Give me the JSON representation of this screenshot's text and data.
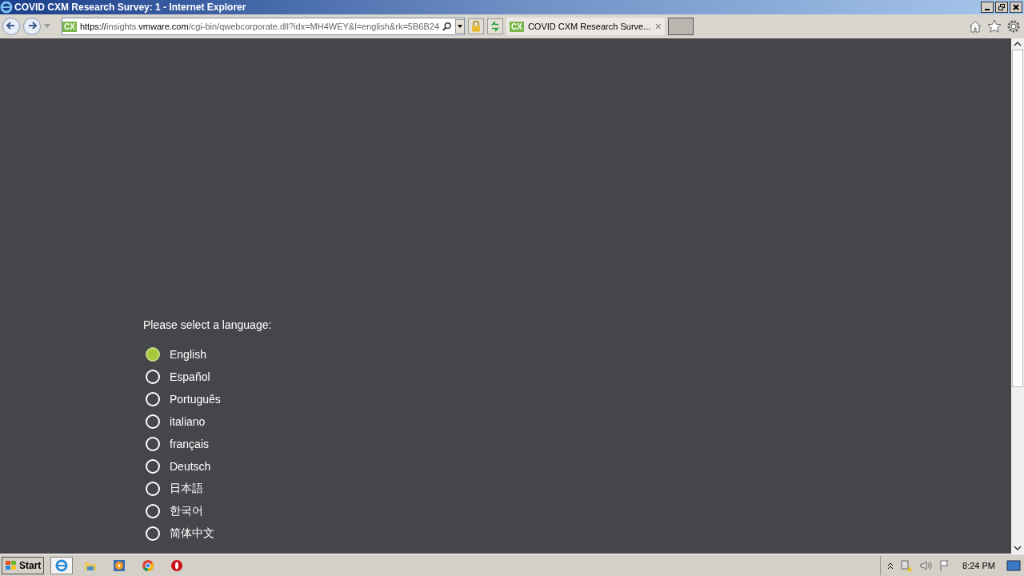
{
  "window": {
    "title": "COVID CXM Research Survey: 1 - Internet Explorer"
  },
  "address_bar": {
    "scheme": "https://",
    "host_prefix": "insights.",
    "host_main": "vmware.com",
    "path": "/cgi-bin/qwebcorporate.dll?idx=MH4WEY&l=english&rk=5B6B24",
    "site_icon": "CX"
  },
  "tabs": [
    {
      "icon": "CX",
      "label": "COVID CXM Research Surve...",
      "selected": true,
      "close": "×"
    }
  ],
  "survey": {
    "question": "Please select a language:",
    "options": [
      {
        "label": "English",
        "selected": true
      },
      {
        "label": "Español",
        "selected": false
      },
      {
        "label": "Português",
        "selected": false
      },
      {
        "label": "italiano",
        "selected": false
      },
      {
        "label": "français",
        "selected": false
      },
      {
        "label": "Deutsch",
        "selected": false
      },
      {
        "label": "日本語",
        "selected": false
      },
      {
        "label": "한국어",
        "selected": false
      },
      {
        "label": "简体中文",
        "selected": false
      }
    ]
  },
  "taskbar": {
    "start": "Start",
    "apps": [
      {
        "kind": "ie",
        "selected": true
      },
      {
        "kind": "folder",
        "selected": false
      },
      {
        "kind": "media",
        "selected": false
      },
      {
        "kind": "chrome",
        "selected": false
      },
      {
        "kind": "opera",
        "selected": false
      }
    ],
    "clock": "8:24 PM"
  }
}
